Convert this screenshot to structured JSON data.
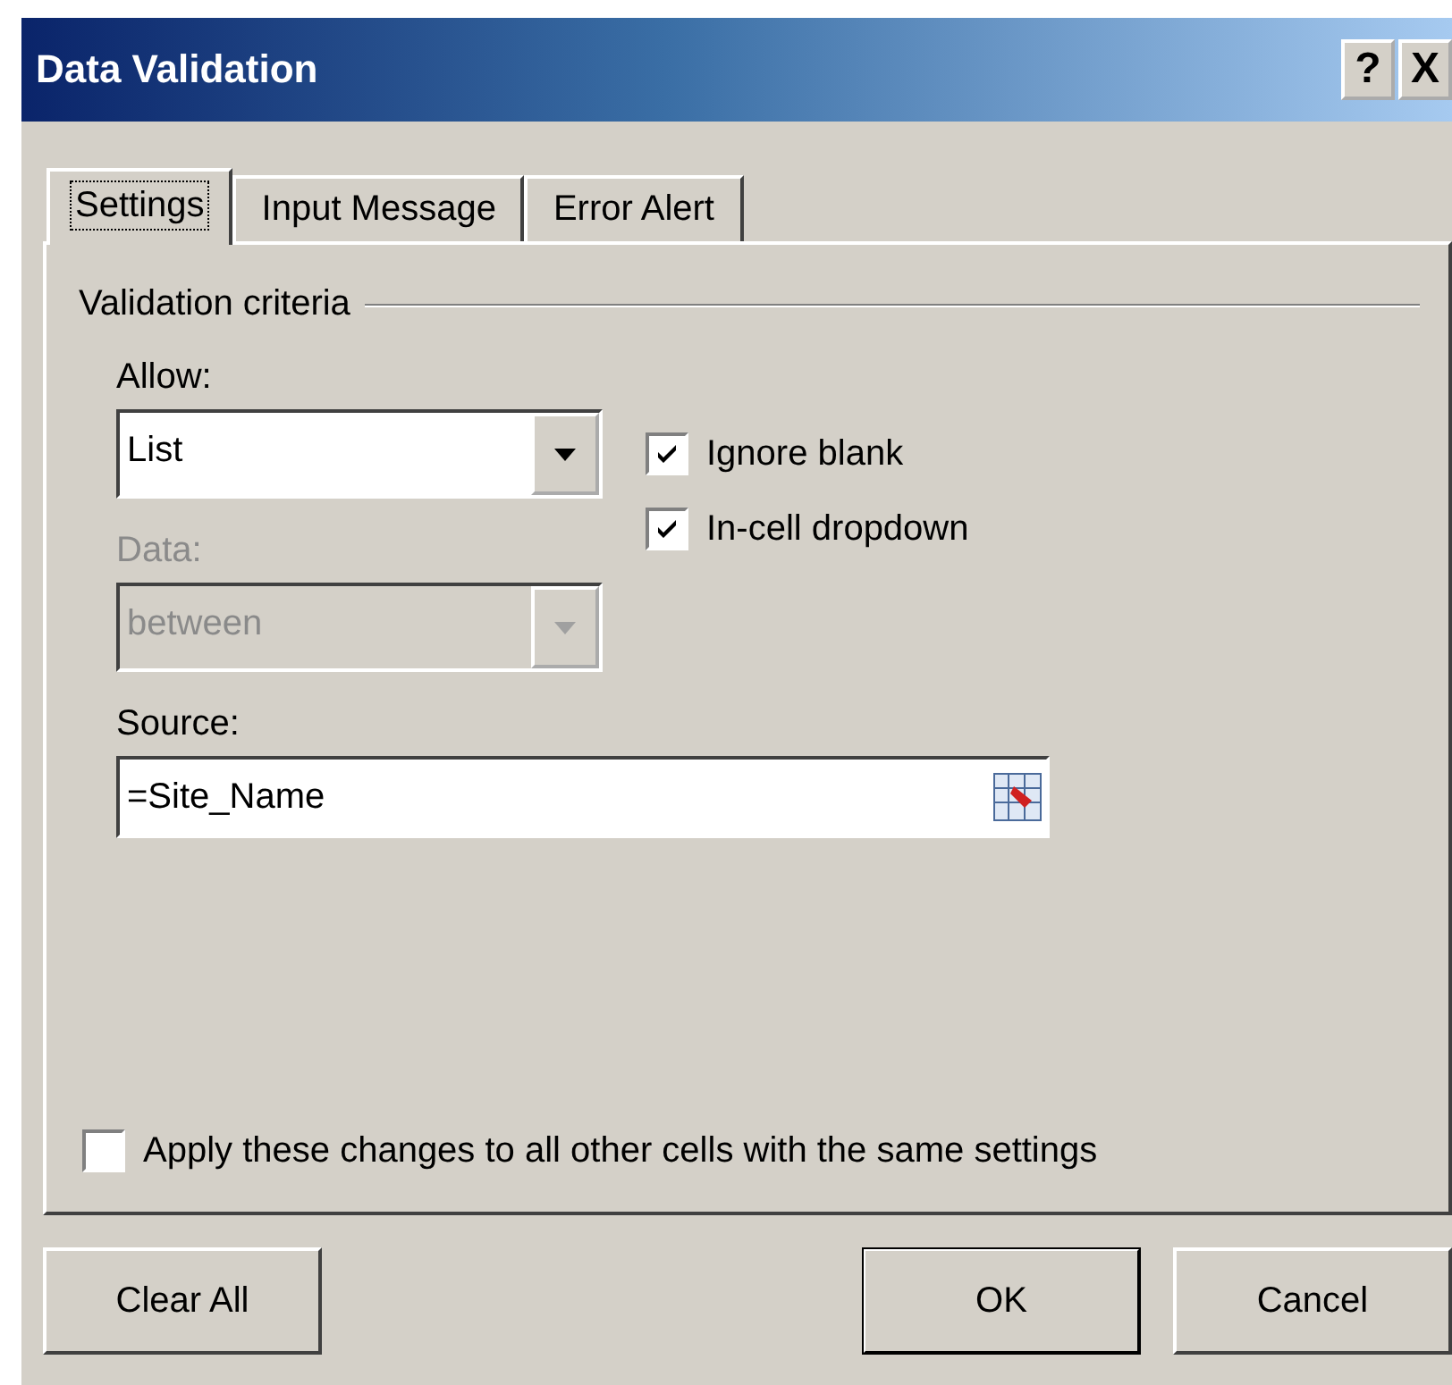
{
  "window": {
    "title": "Data Validation",
    "buttons": [
      "?",
      "X"
    ]
  },
  "tabs": [
    {
      "label": "Settings",
      "selected": true
    },
    {
      "label": "Input Message",
      "selected": false
    },
    {
      "label": "Error Alert",
      "selected": false
    }
  ],
  "group": {
    "title": "Validation criteria"
  },
  "allow": {
    "label": "Allow:",
    "value": "List",
    "disabled": false
  },
  "data": {
    "label": "Data:",
    "value": "between",
    "disabled": true
  },
  "options": [
    {
      "label": "Ignore blank",
      "checked": true
    },
    {
      "label": "In-cell dropdown",
      "checked": true
    }
  ],
  "source": {
    "label": "Source:",
    "value": "=Site_Name"
  },
  "apply_all": {
    "label": "Apply these changes to all other cells with the same settings",
    "checked": false
  },
  "buttons": [
    {
      "label": "Clear All",
      "kind": "left",
      "default": false
    },
    {
      "label": "OK",
      "kind": "right",
      "default": true
    },
    {
      "label": "Cancel",
      "kind": "right",
      "default": false
    }
  ]
}
